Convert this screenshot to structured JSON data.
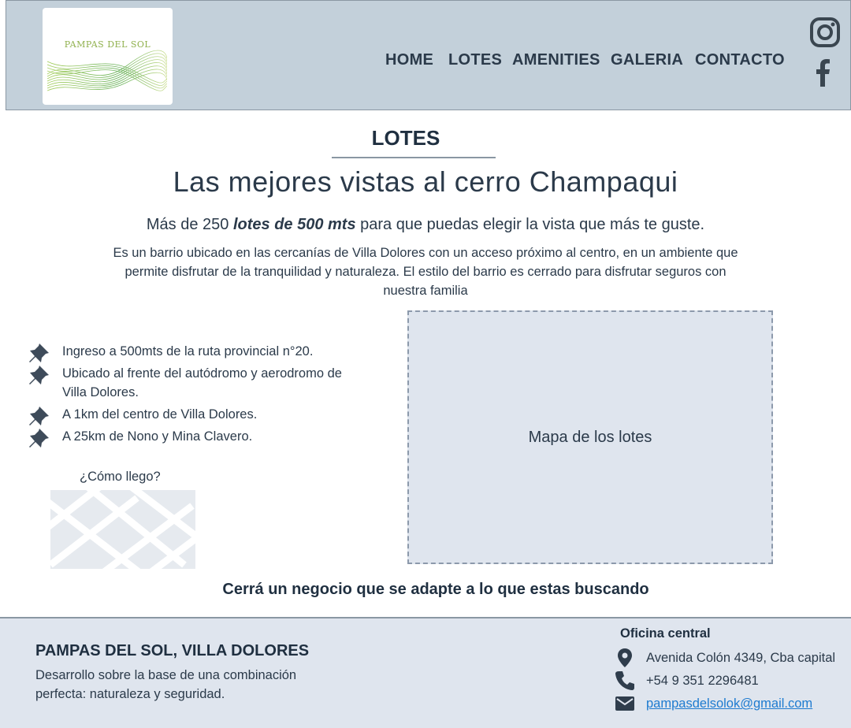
{
  "brand": {
    "logo_text": "PAMPAS DEL SOL"
  },
  "nav": {
    "home": "HOME",
    "lotes": "LOTES",
    "amenities": "AMENITIES",
    "galeria": "GALERIA",
    "contacto": "CONTACTO"
  },
  "social": {
    "instagram": "instagram-icon",
    "facebook": "facebook-icon"
  },
  "section": {
    "title": "LOTES",
    "headline": "Las mejores vistas al cerro Champaqui",
    "sub_before": "Más de 250 ",
    "sub_bold": "lotes de 500 mts",
    "sub_after": " para que puedas elegir la vista que más te guste.",
    "description": "Es un barrio ubicado en las cercanías de Villa Dolores con un acceso próximo al centro, en un ambiente que permite disfrutar de la tranquilidad y naturaleza. El estilo del barrio es cerrado para disfrutar seguros con nuestra familia"
  },
  "features": [
    "Ingreso a 500mts de la ruta provincial n°20.",
    "Ubicado al frente del autódromo y aerodromo de Villa Dolores.",
    "A 1km del centro de Villa Dolores.",
    "A 25km de Nono y Mina Clavero."
  ],
  "how_to_get": "¿Cómo llego?",
  "map_label": "Mapa de los lotes",
  "cta": "Cerrá un negocio que se adapte a lo que estas buscando",
  "footer": {
    "brand": "PAMPAS DEL SOL, VILLA DOLORES",
    "description": "Desarrollo sobre la base de una combinación perfecta: naturaleza y seguridad.",
    "office_title": "Oficina central",
    "address": "Avenida Colón 4349, Cba capital",
    "phone": "+54 9 351 2296481",
    "email": "pampasdelsolok@gmail.com"
  },
  "colors": {
    "header_bg": "#c3d0da",
    "footer_bg": "#dfe5ee",
    "map_bg": "#dfe5ee",
    "text": "#2b3a4a",
    "link": "#1e7bd0",
    "logo_green": "#8fb04c"
  }
}
